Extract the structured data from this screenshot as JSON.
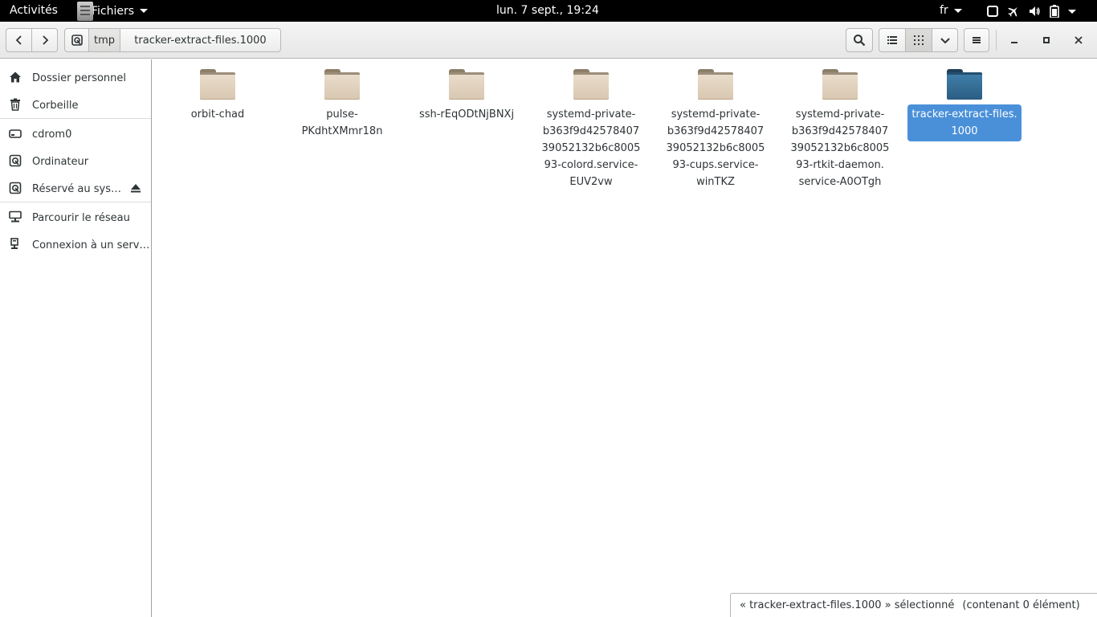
{
  "topbar": {
    "activities": "Activités",
    "app_name": "Fichiers",
    "clock": "lun.  7 sept., 19:24",
    "language": "fr",
    "tray_icons": [
      "window-icon",
      "airplane-icon",
      "volume-icon",
      "battery-icon",
      "system-menu-arrow-icon"
    ]
  },
  "header": {
    "path": {
      "parent": "tmp",
      "current": "tracker-extract-files.1000"
    },
    "view_mode": "grid"
  },
  "sidebar": {
    "items": [
      {
        "label": "Dossier personnel",
        "icon": "home-icon"
      },
      {
        "label": "Corbeille",
        "icon": "trash-icon"
      },
      {
        "label": "cdrom0",
        "icon": "drive-icon"
      },
      {
        "label": "Ordinateur",
        "icon": "computer-icon"
      },
      {
        "label": "Réservé au sys…",
        "icon": "disk-icon"
      },
      {
        "label": "Parcourir le réseau",
        "icon": "network-icon"
      },
      {
        "label": "Connexion à un serv…",
        "icon": "server-icon"
      }
    ]
  },
  "files": [
    {
      "label": "orbit-chad",
      "color": "#d8c7b0",
      "selected": false
    },
    {
      "label": "pulse-\nPKdhtXMmr18n",
      "color": "#d8c7b0",
      "selected": false
    },
    {
      "label": "ssh-rEqODtNjBNXj",
      "color": "#d8c7b0",
      "selected": false
    },
    {
      "label": "systemd-private-\nb363f9d42578407\n39052132b6c8005\n93-colord.service-\nEUV2vw",
      "color": "#d8c7b0",
      "selected": false
    },
    {
      "label": "systemd-private-\nb363f9d42578407\n39052132b6c8005\n93-cups.service-\nwinTKZ",
      "color": "#d8c7b0",
      "selected": false
    },
    {
      "label": "systemd-private-\nb363f9d42578407\n39052132b6c8005\n93-rtkit-daemon.\nservice-A0OTgh",
      "color": "#d8c7b0",
      "selected": false
    },
    {
      "label": "tracker-extract-files.\n1000",
      "color": "#2b5d83",
      "selected": true
    }
  ],
  "status": {
    "selection": "« tracker-extract-files.1000 » sélectionné",
    "details": "(contenant 0 élément)"
  },
  "colors": {
    "accent": "#4a90d9",
    "topbar": "#000000"
  }
}
